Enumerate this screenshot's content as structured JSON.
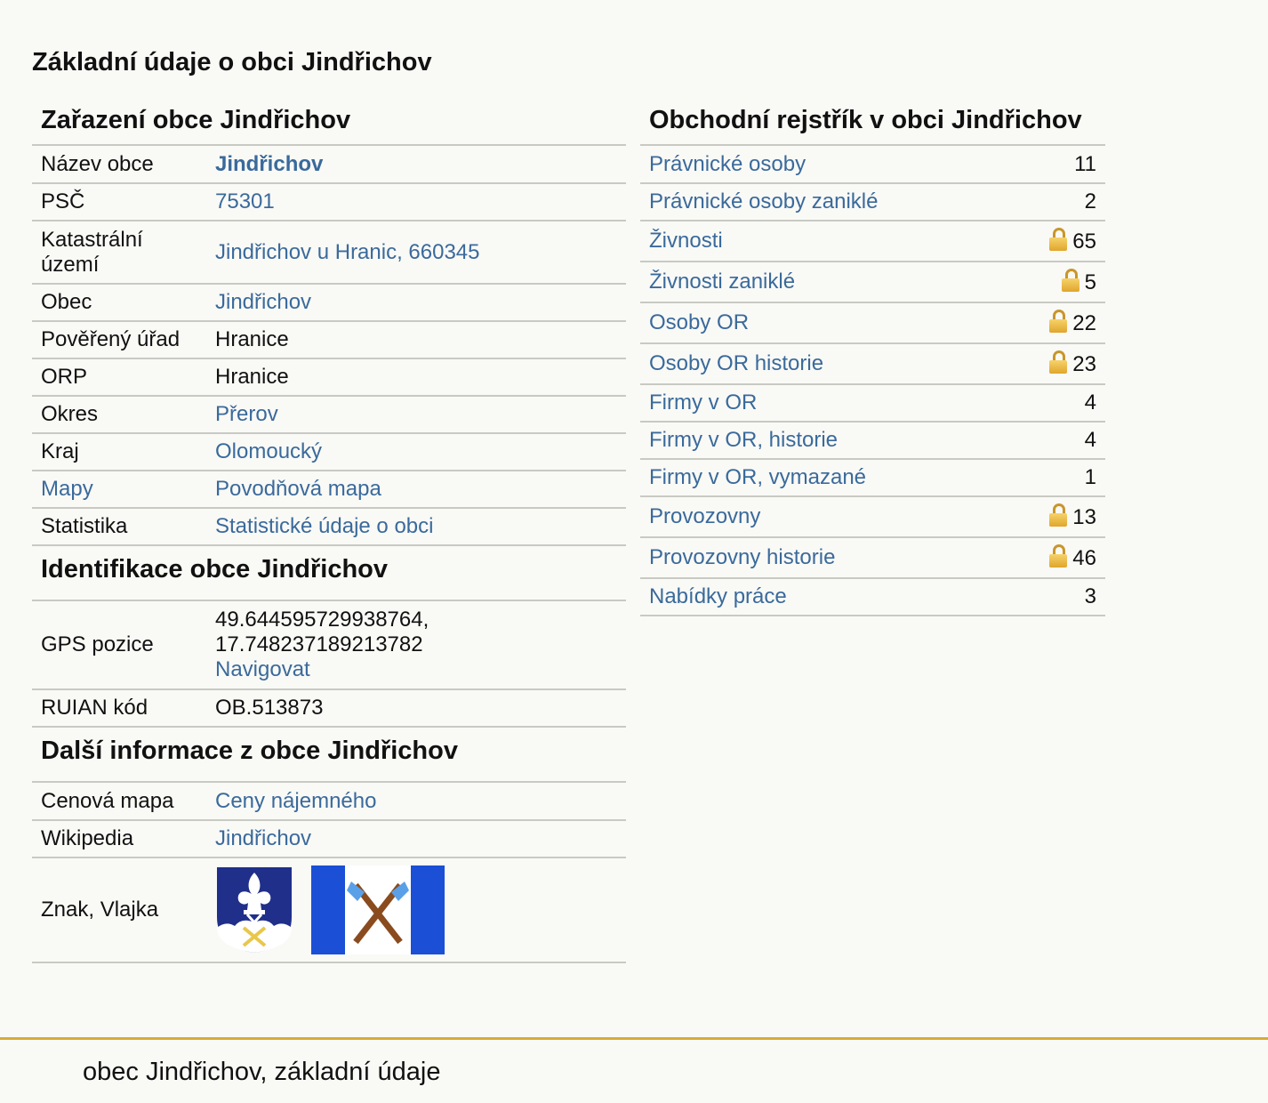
{
  "page_title": "Základní údaje o obci Jindřichov",
  "zarazeni": {
    "heading": "Zařazení obce Jindřichov",
    "rows": [
      {
        "label": "Název obce",
        "value": "Jindřichov"
      },
      {
        "label": "PSČ",
        "value": "75301"
      },
      {
        "label": "Katastrální území",
        "value": "Jindřichov u Hranic, 660345"
      },
      {
        "label": "Obec",
        "value": "Jindřichov"
      },
      {
        "label": "Pověřený úřad",
        "value": "Hranice"
      },
      {
        "label": "ORP",
        "value": "Hranice"
      },
      {
        "label": "Okres",
        "value": "Přerov"
      },
      {
        "label": "Kraj",
        "value": "Olomoucký"
      },
      {
        "label": "Mapy",
        "value": "Povodňová mapa"
      },
      {
        "label": "Statistika",
        "value": "Statistické údaje o obci"
      }
    ]
  },
  "identifikace": {
    "heading": "Identifikace obce Jindřichov",
    "gps_label": "GPS pozice",
    "gps_lat": "49.644595729938764,",
    "gps_lon": "17.748237189213782",
    "gps_link": "Navigovat",
    "ruian_label": "RUIAN kód",
    "ruian_value": "OB.513873"
  },
  "dalsi": {
    "heading": "Další informace z obce Jindřichov",
    "rows": [
      {
        "label": "Cenová mapa",
        "value": "Ceny nájemného"
      },
      {
        "label": "Wikipedia",
        "value": "Jindřichov"
      }
    ],
    "emblem_label": "Znak, Vlajka"
  },
  "rejstrik": {
    "heading": "Obchodní rejstřík v obci Jindřichov",
    "rows": [
      {
        "label": "Právnické osoby",
        "value": "11",
        "locked": false
      },
      {
        "label": "Právnické osoby zaniklé",
        "value": "2",
        "locked": false
      },
      {
        "label": "Živnosti",
        "value": "65",
        "locked": true
      },
      {
        "label": "Živnosti zaniklé",
        "value": "5",
        "locked": true
      },
      {
        "label": "Osoby OR",
        "value": "22",
        "locked": true
      },
      {
        "label": "Osoby OR historie",
        "value": "23",
        "locked": true
      },
      {
        "label": "Firmy v OR",
        "value": "4",
        "locked": false
      },
      {
        "label": "Firmy v OR, historie",
        "value": "4",
        "locked": false
      },
      {
        "label": "Firmy v OR, vymazané",
        "value": "1",
        "locked": false
      },
      {
        "label": "Provozovny",
        "value": "13",
        "locked": true
      },
      {
        "label": "Provozovny historie",
        "value": "46",
        "locked": true
      },
      {
        "label": "Nabídky práce",
        "value": "3",
        "locked": false
      }
    ]
  },
  "footer": {
    "text": "obec Jindřichov, základní údaje"
  },
  "colors": {
    "link": "#3a6a9b",
    "accent": "#d8ab35",
    "flag_blue": "#1a4fd6",
    "coat_blue": "#1f2f8a"
  }
}
